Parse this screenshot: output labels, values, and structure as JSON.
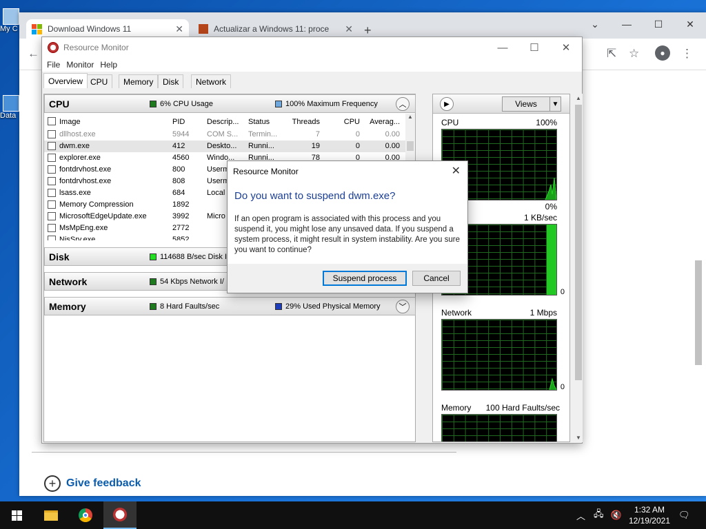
{
  "desktop": {
    "icons": [
      {
        "label": "My C"
      },
      {
        "label": "Data"
      }
    ]
  },
  "browser": {
    "tabs": [
      {
        "title": "Download Windows 11",
        "active": true
      },
      {
        "title": "Actualizar a Windows 11: proce",
        "active": false
      }
    ],
    "feedback_label": "Give feedback"
  },
  "resmon": {
    "title": "Resource Monitor",
    "menu": [
      "File",
      "Monitor",
      "Help"
    ],
    "tabs": [
      "Overview",
      "CPU",
      "Memory",
      "Disk",
      "Network"
    ],
    "cpu": {
      "name": "CPU",
      "usage": "6% CPU Usage",
      "usage_color": "#1f7a1f",
      "freq": "100% Maximum Frequency",
      "freq_color": "#6fa8dc",
      "columns": {
        "image": "Image",
        "pid": "PID",
        "desc": "Descrip...",
        "status": "Status",
        "threads": "Threads",
        "cpu": "CPU",
        "avg": "Averag..."
      },
      "rows": [
        {
          "image": "dllhost.exe",
          "pid": "5944",
          "desc": "COM S...",
          "status": "Termin...",
          "threads": "7",
          "cpu": "0",
          "avg": "0.00"
        },
        {
          "image": "dwm.exe",
          "pid": "412",
          "desc": "Deskto...",
          "status": "Runni...",
          "threads": "19",
          "cpu": "0",
          "avg": "0.00"
        },
        {
          "image": "explorer.exe",
          "pid": "4560",
          "desc": "Windo...",
          "status": "Runni...",
          "threads": "78",
          "cpu": "0",
          "avg": "0.00"
        },
        {
          "image": "fontdrvhost.exe",
          "pid": "800",
          "desc": "Userm",
          "status": "",
          "threads": "",
          "cpu": "",
          "avg": ""
        },
        {
          "image": "fontdrvhost.exe",
          "pid": "808",
          "desc": "Userm",
          "status": "",
          "threads": "",
          "cpu": "",
          "avg": ""
        },
        {
          "image": "lsass.exe",
          "pid": "684",
          "desc": "Local S",
          "status": "",
          "threads": "",
          "cpu": "",
          "avg": ""
        },
        {
          "image": "Memory Compression",
          "pid": "1892",
          "desc": "",
          "status": "",
          "threads": "",
          "cpu": "",
          "avg": ""
        },
        {
          "image": "MicrosoftEdgeUpdate.exe",
          "pid": "3992",
          "desc": "Micro",
          "status": "",
          "threads": "",
          "cpu": "",
          "avg": ""
        },
        {
          "image": "MsMpEng.exe",
          "pid": "2772",
          "desc": "",
          "status": "",
          "threads": "",
          "cpu": "",
          "avg": ""
        },
        {
          "image": "NisSrv.exe",
          "pid": "5852",
          "desc": "",
          "status": "",
          "threads": "",
          "cpu": "",
          "avg": ""
        }
      ]
    },
    "disk": {
      "name": "Disk",
      "usage": "114688 B/sec Disk I/",
      "usage_color": "#22dd22"
    },
    "network": {
      "name": "Network",
      "usage": "54 Kbps Network I/",
      "usage_color": "#1f7a1f"
    },
    "memory": {
      "name": "Memory",
      "faults": "8 Hard Faults/sec",
      "faults_color": "#1f7a1f",
      "used": "29% Used Physical Memory",
      "used_color": "#1f3fbf"
    },
    "graphs": {
      "views_label": "Views",
      "cpu": {
        "label": "CPU",
        "max": "100%",
        "min": "0%",
        "sub": "nds"
      },
      "disk": {
        "label": "",
        "max": "1 KB/sec",
        "min": "0"
      },
      "network": {
        "label": "Network",
        "max": "1 Mbps",
        "min": "0"
      },
      "memory": {
        "label": "Memory",
        "max": "100 Hard Faults/sec"
      }
    }
  },
  "dialog": {
    "title": "Resource Monitor",
    "heading": "Do you want to suspend dwm.exe?",
    "body": "If an open program is associated with this process and you suspend it, you might lose any unsaved data. If you suspend a system process, it might result in system instability. Are you sure you want to continue?",
    "primary_label": "Suspend process",
    "cancel_label": "Cancel"
  },
  "taskbar": {
    "time": "1:32 AM",
    "date": "12/19/2021"
  }
}
